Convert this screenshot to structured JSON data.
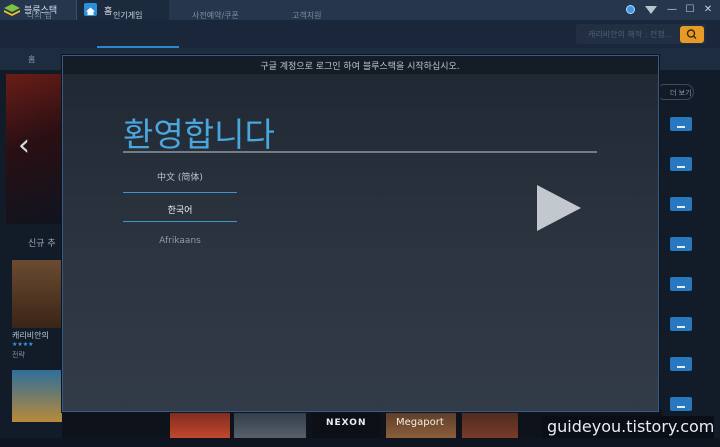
{
  "titlebar": {
    "app_name": "블루스택",
    "home_tab": "홈",
    "icons": [
      "bluestacks-logo-icon",
      "home-icon",
      "notification-dot-icon",
      "wifi-icon",
      "minimize-icon",
      "maximize-icon",
      "close-icon"
    ]
  },
  "nav": {
    "items": [
      "나의 앱",
      "인기게임",
      "사전예약/쿠폰",
      "고객지원"
    ],
    "active_index": 1,
    "search_placeholder": "캐리비안의 해적 : 전쟁..."
  },
  "subnav": {
    "label": "홈"
  },
  "background": {
    "section_title": "신규 추",
    "game_name": "캐리비안의",
    "game_category": "전략",
    "game_rating": 5,
    "more_label": "더 보기",
    "strip_brands": [
      "NEXON",
      "Megaport"
    ]
  },
  "modal": {
    "header": "구글 계정으로 로그인 하여 블루스택을 시작하십시오.",
    "welcome": "환영합니다",
    "languages": [
      "中文 (简体)",
      "한국어",
      "Afrikaans"
    ],
    "selected_language": "한국어"
  },
  "watermark": "guideyou.tistory.com",
  "colors": {
    "accent": "#2f86cc",
    "welcome_text": "#4aa6dd",
    "search_button": "#e79a25",
    "download_button": "#2777c1"
  }
}
